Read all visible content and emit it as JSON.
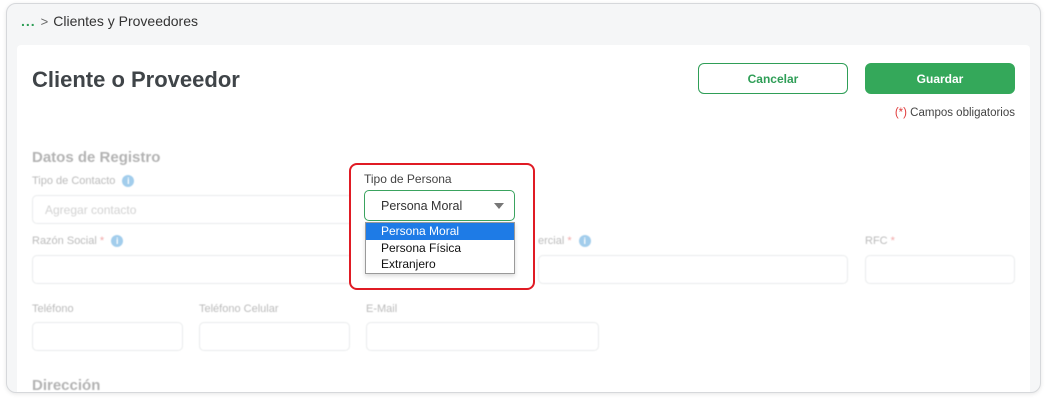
{
  "breadcrumb": {
    "dots": "...",
    "separator": ">",
    "current": "Clientes y Proveedores"
  },
  "page": {
    "title": "Cliente o Proveedor",
    "cancel_label": "Cancelar",
    "save_label": "Guardar",
    "required_star": "(*)",
    "required_text": " Campos obligatorios"
  },
  "form": {
    "section_title": "Datos de Registro",
    "tipo_contacto_label": "Tipo de Contacto",
    "tipo_contacto_placeholder": "Agregar contacto",
    "razon_social_label": "Razón Social",
    "nombre_comercial_label": "ercial",
    "rfc_label": "RFC",
    "required_mark": " *",
    "telefono_label": "Teléfono",
    "telefono_celular_label": "Teléfono Celular",
    "email_label": "E-Mail",
    "direccion_title": "Dirección",
    "info_glyph": "i"
  },
  "tipo_persona": {
    "label": "Tipo de Persona",
    "selected": "Persona Moral",
    "options": [
      "Persona Moral",
      "Persona Física",
      "Extranjero"
    ]
  },
  "colors": {
    "accent": "#34a85a",
    "highlight": "#e01b24",
    "selection": "#1e7be6"
  },
  "icons": {
    "dropdown": "chevron-down-icon",
    "info": "info-icon"
  }
}
